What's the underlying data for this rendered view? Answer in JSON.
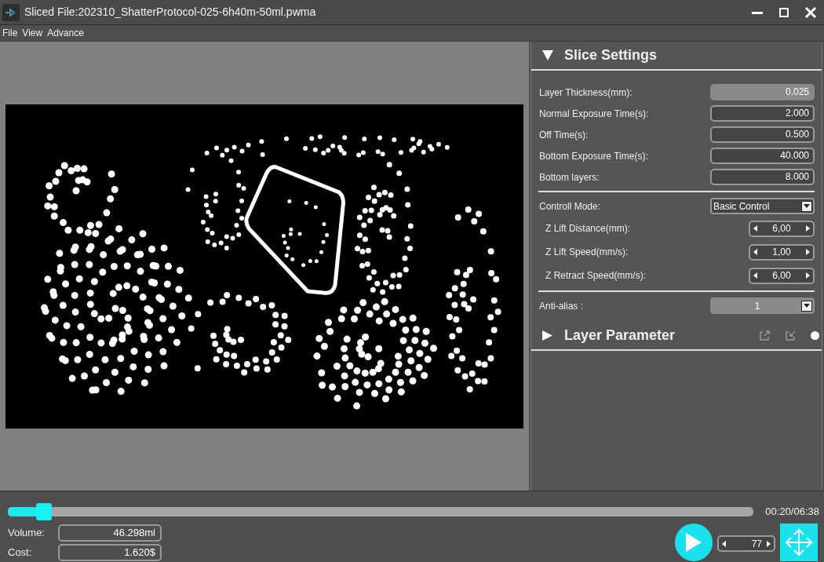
{
  "window": {
    "title": "Sliced File:202310_ShatterProtocol-025-6h40m-50ml.pwma"
  },
  "menu": [
    "File",
    "View",
    "Advance"
  ],
  "slice_settings": {
    "title": "Slice Settings",
    "expanded": true,
    "groups": [
      {
        "fields": [
          {
            "kind": "number",
            "label": "Layer Thickness(mm):",
            "value": "0.025",
            "disabled": true
          },
          {
            "kind": "number",
            "label": "Normal Exposure Time(s):",
            "value": "2.000",
            "disabled": false
          },
          {
            "kind": "number",
            "label": "Off Time(s):",
            "value": "0.500",
            "disabled": false
          },
          {
            "kind": "number",
            "label": "Bottom Exposure Time(s):",
            "value": "40.000",
            "disabled": false
          },
          {
            "kind": "number",
            "label": "Bottom layers:",
            "value": "8.000",
            "disabled": false
          }
        ]
      },
      {
        "fields": [
          {
            "kind": "select",
            "label": "Controll Mode:",
            "value": "Basic Control",
            "disabled": false
          },
          {
            "kind": "spinner",
            "label": "Z Lift Distance(mm):",
            "value": "6,00",
            "disabled": false
          },
          {
            "kind": "spinner",
            "label": "Z Lift Speed(mm/s):",
            "value": "1,00",
            "disabled": false
          },
          {
            "kind": "spinner",
            "label": "Z Retract Speed(mm/s):",
            "value": "6,00",
            "disabled": false
          }
        ]
      },
      {
        "fields": [
          {
            "kind": "select",
            "label": "Anti-alias :",
            "value": "1",
            "disabled": true
          }
        ]
      }
    ]
  },
  "layer_parameter": {
    "title": "Layer Parameter",
    "expanded": false
  },
  "timeline": {
    "level": 0.048,
    "time": "00:20/06:38"
  },
  "stats": [
    {
      "label": "Volume:",
      "value": "46.298ml"
    },
    {
      "label": "Cost:",
      "value": "1.620$"
    }
  ],
  "layer_spinner": {
    "value": "77"
  }
}
